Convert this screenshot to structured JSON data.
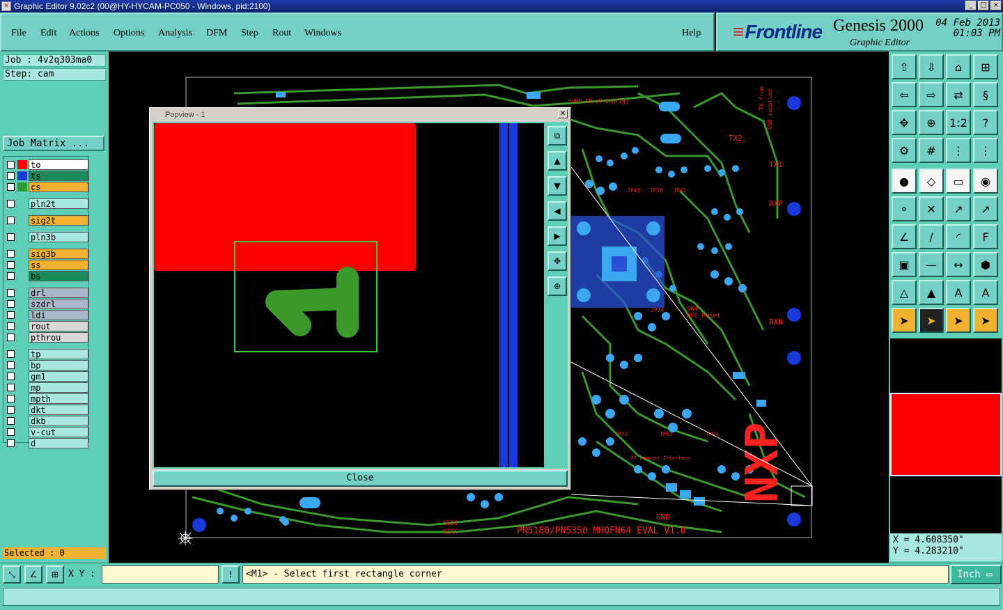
{
  "window": {
    "title": "Graphic Editor 9.02c2 (00@HY-HYCAM-PC050 - Windows, pid:2100)",
    "minimize": "_",
    "maximize": "□",
    "close": "×"
  },
  "menu": [
    "File",
    "Edit",
    "Actions",
    "Options",
    "Analysis",
    "DFM",
    "Step",
    "Rout",
    "Windows"
  ],
  "help": "Help",
  "brand": {
    "logo": "Frontline",
    "product": "Genesis 2000",
    "subtitle": "Graphic Editor",
    "date": "04 Feb 2013",
    "time": "01:03 PM"
  },
  "job": {
    "label": "Job : 4v2q303ma0",
    "step": "Step: cam",
    "matrix_button": "Job Matrix ..."
  },
  "layers": [
    {
      "name": "to",
      "color": "#ffffff",
      "swatch": "#ff0000"
    },
    {
      "name": "ts",
      "color": "#1a8a5a",
      "swatch": "#1a3adc"
    },
    {
      "name": "cs",
      "color": "#f0b030",
      "swatch": "#2a9a2a"
    },
    {
      "name": "pln2t",
      "color": "#a8e8e0",
      "swatch": ""
    },
    {
      "name": "sig2t",
      "color": "#f0b030",
      "swatch": ""
    },
    {
      "name": "pln3b",
      "color": "#a8e8e0",
      "swatch": ""
    },
    {
      "name": "sig3b",
      "color": "#f0b030",
      "swatch": ""
    },
    {
      "name": "ss",
      "color": "#f0b030",
      "swatch": ""
    },
    {
      "name": "bs",
      "color": "#1a8a5a",
      "swatch": ""
    },
    {
      "name": "drl",
      "color": "#a8b8c8",
      "swatch": ""
    },
    {
      "name": "szdrl",
      "color": "#a8b8c8",
      "swatch": ""
    },
    {
      "name": "ldi",
      "color": "#a8b8c8",
      "swatch": ""
    },
    {
      "name": "rout",
      "color": "#d8d8d8",
      "swatch": ""
    },
    {
      "name": "pthrou",
      "color": "#d8d8d8",
      "swatch": ""
    },
    {
      "name": "tp",
      "color": "#a8e8e0",
      "swatch": ""
    },
    {
      "name": "bp",
      "color": "#a8e8e0",
      "swatch": ""
    },
    {
      "name": "gm1",
      "color": "#a8e8e0",
      "swatch": ""
    },
    {
      "name": "mp",
      "color": "#a8e8e0",
      "swatch": ""
    },
    {
      "name": "mpth",
      "color": "#a8e8e0",
      "swatch": ""
    },
    {
      "name": "dkt",
      "color": "#a8e8e0",
      "swatch": ""
    },
    {
      "name": "dkb",
      "color": "#a8e8e0",
      "swatch": ""
    },
    {
      "name": "v-cut",
      "color": "#a8e8e0",
      "swatch": ""
    },
    {
      "name": "d",
      "color": "#a8e8e0",
      "swatch": ""
    }
  ],
  "selected": "Selected : 0",
  "popup": {
    "title": "Popview - 1",
    "close_label": "Close"
  },
  "coords": {
    "x": "X = 4.608350\"",
    "y": "Y = 4.283210\""
  },
  "status": {
    "xy_label": "X Y :",
    "xy_value": "",
    "message": "<M1> - Select first rectangle corner",
    "unit": "Inch"
  },
  "pcb_labels": {
    "tx2": "TX2",
    "tx1": "TX1",
    "rxp": "RXP",
    "rxn": "RXN",
    "gnd": "GND",
    "sw4": "SW4",
    "nfc_reset": "NFC Reset",
    "tx_from": "TX from",
    "usb_supplied": "USB supplied",
    "footer": "PN5180/PN5350 MHQFN64 EVAL V1.0",
    "logo": "NXP",
    "hvdd": "5VDD_IN (V Config)",
    "jp48": "JP48",
    "jp38": "JP38",
    "jp42": "JP42",
    "jp74": "JP74",
    "jp73": "JP73",
    "jp63": "JP63",
    "jp64": "JP64",
    "rf_booster": "RF Booster Interface",
    "sldi": "SLDI",
    "uicc": "UICC"
  },
  "colors": {
    "copper": "#3a9a2a",
    "pads": "#3aa8f0",
    "silk": "#ff2020",
    "highlight": "#1a3adc"
  }
}
